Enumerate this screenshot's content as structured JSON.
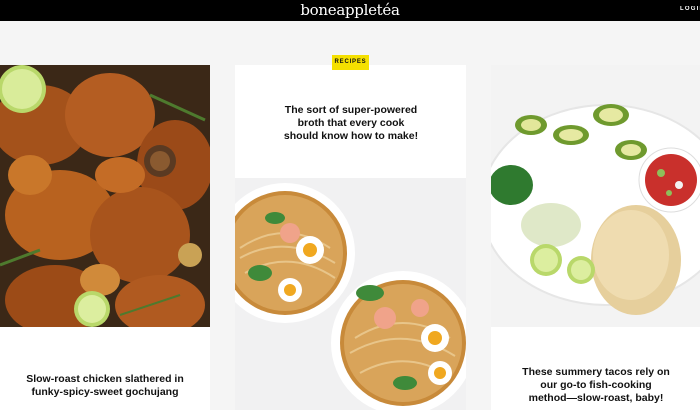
{
  "header": {
    "logo": "boneappletéa",
    "login": "LOGIN"
  },
  "cards": [
    {
      "image": "roast-chicken-photo",
      "caption": "Slow-roast chicken slathered in funky-spicy-sweet gochujang"
    },
    {
      "badge": "RECIPES",
      "caption": "The sort of super-powered broth that every cook should know how to make!",
      "image": "ramen-bowls-photo"
    },
    {
      "image": "fish-tacos-platter-photo",
      "caption": "These summery tacos rely on our go-to fish-cooking method—slow-roast, baby!"
    }
  ],
  "colors": {
    "topbar": "#000000",
    "badge": "#f5e000",
    "page_bg": "#f5f5f5",
    "card_bg": "#ffffff"
  }
}
